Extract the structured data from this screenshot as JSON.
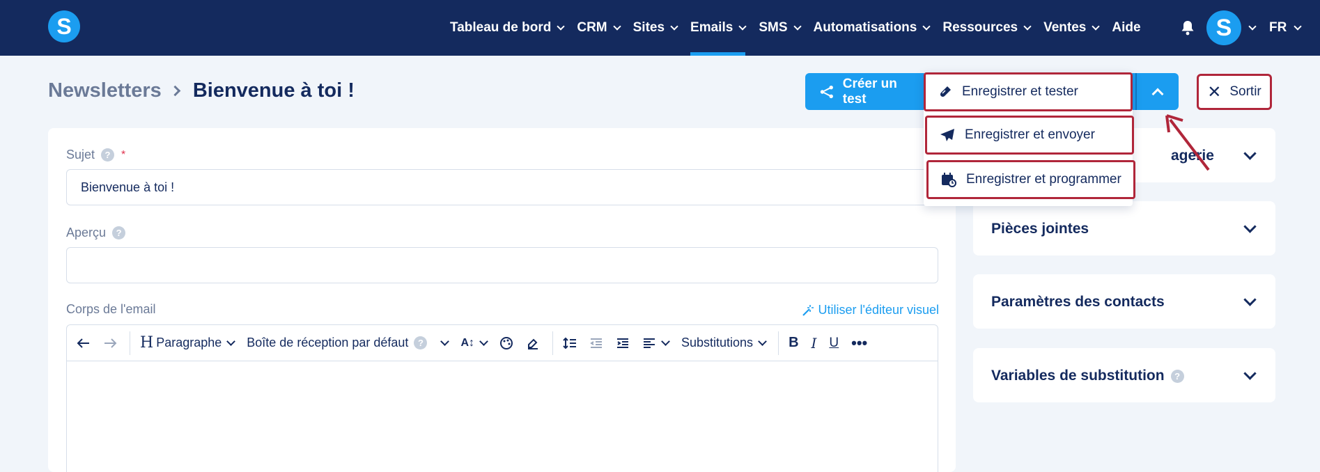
{
  "nav": {
    "items": [
      {
        "label": "Tableau de bord",
        "chevron": true,
        "active": false
      },
      {
        "label": "CRM",
        "chevron": true,
        "active": false
      },
      {
        "label": "Sites",
        "chevron": true,
        "active": false
      },
      {
        "label": "Emails",
        "chevron": true,
        "active": true
      },
      {
        "label": "SMS",
        "chevron": true,
        "active": false
      },
      {
        "label": "Automatisations",
        "chevron": true,
        "active": false
      },
      {
        "label": "Ressources",
        "chevron": true,
        "active": false
      },
      {
        "label": "Ventes",
        "chevron": true,
        "active": false
      },
      {
        "label": "Aide",
        "chevron": false,
        "active": false
      }
    ],
    "logo_letter": "S",
    "avatar_letter": "S",
    "language": "FR"
  },
  "breadcrumb": {
    "parent": "Newsletters",
    "current": "Bienvenue à toi !"
  },
  "actions": {
    "create_test": "Créer un test",
    "exit": "Sortir",
    "menu": {
      "save_test": "Enregistrer et tester",
      "save_send": "Enregistrer et envoyer",
      "save_schedule": "Enregistrer et programmer"
    }
  },
  "form": {
    "subject_label": "Sujet",
    "subject_required": "*",
    "subject_value": "Bienvenue à toi !",
    "preview_label": "Aperçu",
    "preview_value": "",
    "body_label": "Corps de l'email",
    "visual_editor_link": "Utiliser l'éditeur visuel",
    "help_glyph": "?"
  },
  "toolbar": {
    "paragraph": "Paragraphe",
    "inbox": "Boîte de réception par défaut",
    "substitutions": "Substitutions"
  },
  "side_panels": {
    "inbox_partial": "agerie",
    "attachments": "Pièces jointes",
    "contact_settings": "Paramètres des contacts",
    "substitution_vars": "Variables de substitution"
  },
  "colors": {
    "nav_bg": "#142a5e",
    "accent": "#1b9df0",
    "highlight_border": "#b0263a",
    "page_bg": "#f1f5fa"
  }
}
